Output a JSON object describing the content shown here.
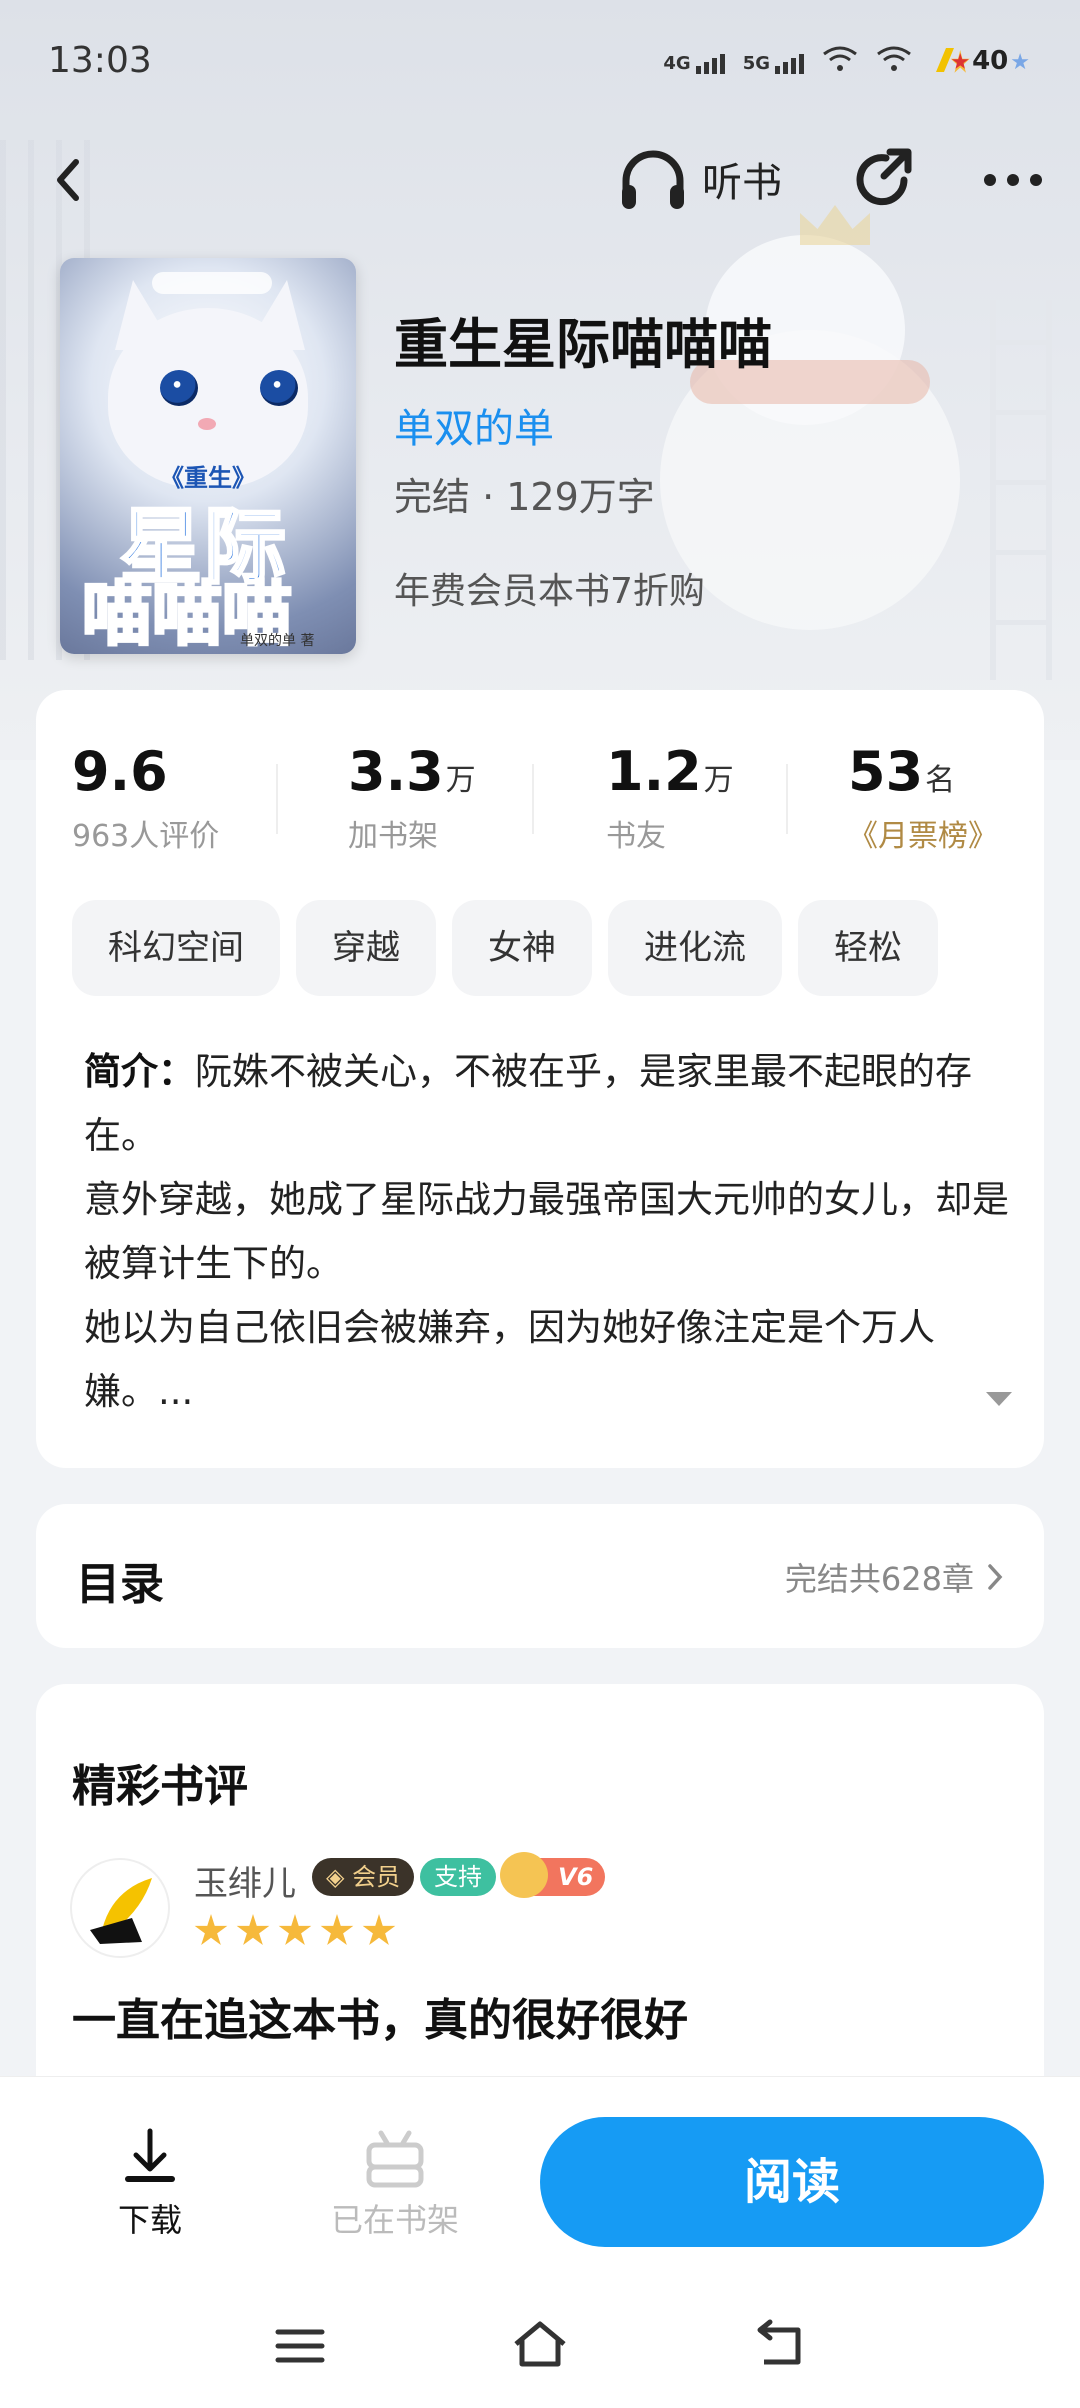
{
  "status_bar": {
    "time": "13:03",
    "net1": "4G",
    "net2": "5G",
    "battery": "40"
  },
  "nav": {
    "listen_label": "听书"
  },
  "book": {
    "cover": {
      "small_title": "《重生》",
      "title_line1": "星际",
      "title_line2": "喵喵喵",
      "author_sig": "单双的单 著"
    },
    "title": "重生星际喵喵喵",
    "author": "单双的单",
    "status": "完结 · 129万字",
    "vip_offer": "年费会员本书7折购"
  },
  "stats": [
    {
      "value": "9.6",
      "unit": "",
      "label": "963人评价"
    },
    {
      "value": "3.3",
      "unit": "万",
      "label": "加书架"
    },
    {
      "value": "1.2",
      "unit": "万",
      "label": "书友"
    },
    {
      "value": "53",
      "unit": "名",
      "label": "月票榜"
    }
  ],
  "tags": [
    "科幻空间",
    "穿越",
    "女神",
    "进化流",
    "轻松"
  ],
  "intro": {
    "label": "简介：",
    "line1": "阮姝不被关心，不被在乎，是家里最不起眼的存在。",
    "line2": "意外穿越，她成了星际战力最强帝国大元帅的女儿，却是被算计生下的。",
    "line3": "她以为自己依旧会被嫌弃，因为她好像注定是个万人嫌。..."
  },
  "toc": {
    "label": "目录",
    "info": "完结共628章"
  },
  "reviews": {
    "title": "精彩书评",
    "item": {
      "name": "玉绯儿",
      "badge_vip": "会员",
      "badge_support": "支持",
      "badge_level": "V6",
      "stars": 5,
      "text": "一直在追这本书，真的很好很好"
    }
  },
  "bottom": {
    "download": "下载",
    "on_shelf": "已在书架",
    "read": "阅读"
  },
  "colors": {
    "accent": "#169bf4",
    "author": "#1a8fef",
    "rank": "#b08a44",
    "star": "#f6b93b"
  }
}
